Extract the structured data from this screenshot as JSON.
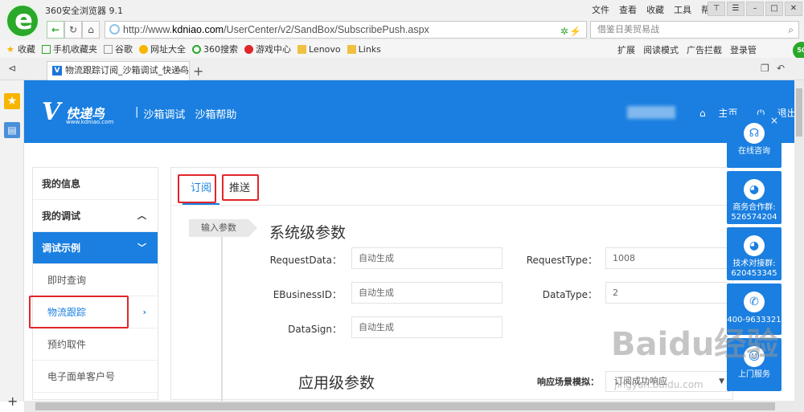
{
  "browser": {
    "title": "360安全浏览器 9.1",
    "menu": [
      "文件",
      "查看",
      "收藏",
      "工具",
      "帮助"
    ],
    "url_prefix": "http://www.",
    "url_domain": "kdniao.com",
    "url_path": "/UserCenter/v2/SandBox/SubscribePush.aspx",
    "search_placeholder": "借鉴日美贸易战",
    "bookmarks": [
      "收藏",
      "手机收藏夹",
      "谷歌",
      "网址大全",
      "360搜索",
      "游戏中心",
      "Lenovo",
      "Links"
    ],
    "bookmarks_right": [
      "扩展",
      "阅读模式",
      "广告拦截",
      "登录管"
    ],
    "tab_title": "物流跟踪订阅_沙箱调试_快递鸟",
    "green_badge": "50"
  },
  "site": {
    "logo_name": "快递鸟",
    "logo_url": "www.kdniao.com",
    "nav_sandbox": "沙箱调试",
    "nav_help": "沙箱帮助",
    "home": "主页",
    "logout": "退出"
  },
  "sidebar": {
    "items": [
      {
        "label": "我的信息"
      },
      {
        "label": "我的调试"
      },
      {
        "label": "调试示例"
      },
      {
        "label": "即时查询"
      },
      {
        "label": "物流跟踪"
      },
      {
        "label": "预约取件"
      },
      {
        "label": "电子面单客户号"
      }
    ]
  },
  "main": {
    "tab_subscribe": "订阅",
    "tab_push": "推送",
    "step_label": "输入参数",
    "section_system": "系统级参数",
    "section_app": "应用级参数",
    "fields": {
      "request_data_label": "RequestData：",
      "request_data_value": "自动生成",
      "ebusiness_label": "EBusinessID：",
      "ebusiness_value": "自动生成",
      "datasign_label": "DataSign：",
      "datasign_value": "自动生成",
      "request_type_label": "RequestType：",
      "request_type_value": "1008",
      "data_type_label": "DataType：",
      "data_type_value": "2"
    },
    "scenario_label": "响应场景模拟：",
    "scenario_value": "订阅成功响应"
  },
  "service": {
    "online": "在线咨询",
    "biz_group_label": "商务合作群:",
    "biz_group_number": "526574204",
    "tech_group_label": "技术对接群:",
    "tech_group_number": "620453345",
    "phone": "400-9633321",
    "upper": "上门服务"
  },
  "watermark": {
    "brand": "Baidu经验",
    "url": "jingyan.baidu.com"
  },
  "colors": {
    "brand_blue": "#1a7fe0",
    "highlight_red": "#e0262a",
    "browser_green": "#2aa82a"
  }
}
